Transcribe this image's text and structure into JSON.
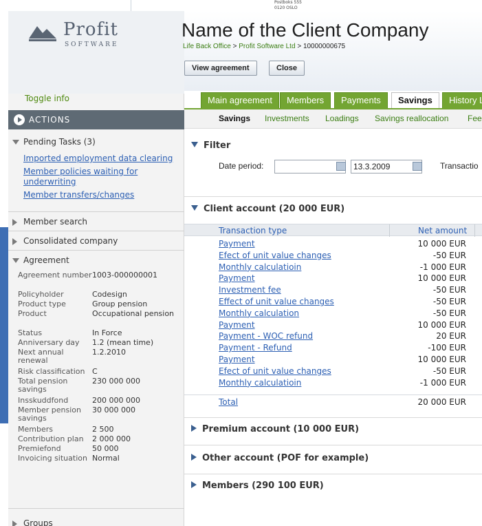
{
  "background": {
    "address_lines": [
      "Postboks 555",
      "0120 OSLO"
    ]
  },
  "logo": {
    "name": "Profit",
    "sub": "SOFTWARE"
  },
  "sidebar": {
    "toggle_info": "Toggle info",
    "actions_label": "ACTIONS",
    "pending_tasks": {
      "title": "Pending Tasks (3)",
      "links": [
        "Imported employment data clearing",
        "Member policies waiting for underwriting",
        "Member transfers/changes"
      ]
    },
    "sections": {
      "member_search": "Member search",
      "consolidated_company": "Consolidated company",
      "agreement": "Agreement",
      "groups": "Groups"
    },
    "agreement_rows": [
      {
        "label": "Agreement number",
        "value": "1003-000000001"
      },
      {
        "label": "Policyholder",
        "value": "Codesign"
      },
      {
        "label": "Product type",
        "value": "Group pension"
      },
      {
        "label": "Product",
        "value": "Occupational pension"
      },
      {
        "label": "Status",
        "value": "In Force"
      },
      {
        "label": "Anniversary day",
        "value": "1.2 (mean time)"
      },
      {
        "label": "Next annual renewal",
        "value": "1.2.2010"
      },
      {
        "label": "Risk classification",
        "value": "C"
      },
      {
        "label": "Total pension savings",
        "value": "230 000 000"
      },
      {
        "label": "Insskuddfond",
        "value": "200 000 000"
      },
      {
        "label": "Member pension savings",
        "value": "30 000 000"
      },
      {
        "label": "Members",
        "value": "2 500"
      },
      {
        "label": "Contribution plan",
        "value": "2 000 000"
      },
      {
        "label": "Premiefond",
        "value": "50 000"
      },
      {
        "label": "Invoicing situation",
        "value": "Normal"
      }
    ]
  },
  "header": {
    "title": "Name of the Client Company",
    "breadcrumb": {
      "first": "Life Back Office",
      "second": "Profit Software Ltd",
      "third": "10000000675",
      "sep": ">"
    },
    "buttons": {
      "view_agreement": "View agreement",
      "close": "Close"
    }
  },
  "tabs": [
    "Main agreement",
    "Members",
    "Payments",
    "Savings",
    "History L"
  ],
  "active_tab": "Savings",
  "subnav": [
    "Savings",
    "Investments",
    "Loadings",
    "Savings reallocation",
    "Fee"
  ],
  "filter": {
    "title": "Filter",
    "date_period_label": "Date period:",
    "date_from": "",
    "date_to": "13.3.2009",
    "transaction_label": "Transactio"
  },
  "client_account": {
    "title": "Client account (20 000 EUR)",
    "columns": [
      "Transaction type",
      "Net amount"
    ],
    "rows": [
      {
        "type": "Payment",
        "amount": "10 000 EUR"
      },
      {
        "type": "Efect of unit value changes",
        "amount": "-50 EUR"
      },
      {
        "type": "Monthly calculatioin",
        "amount": "-1 000 EUR"
      },
      {
        "type": "Payment",
        "amount": "10 000 EUR"
      },
      {
        "type": "Investment fee",
        "amount": "-50 EUR"
      },
      {
        "type": "Effect of unit value changes",
        "amount": "-50 EUR"
      },
      {
        "type": "Monthly calculation",
        "amount": "-50 EUR"
      },
      {
        "type": "Payment",
        "amount": "10 000 EUR"
      },
      {
        "type": "Payment - WOC refund",
        "amount": "20 EUR"
      },
      {
        "type": "Payment - Refund",
        "amount": "-100 EUR"
      },
      {
        "type": "Payment",
        "amount": "10 000 EUR"
      },
      {
        "type": "Efect of unit value changes",
        "amount": "-50 EUR"
      },
      {
        "type": "Monthly calculatioin",
        "amount": "-1 000 EUR"
      }
    ],
    "total_label": "Total",
    "total_amount": "20 000 EUR"
  },
  "collapsed_sections": [
    "Premium account (10 000 EUR)",
    "Other account (POF for example)",
    "Members (290 100 EUR)"
  ],
  "colors": {
    "tab_green": "#73a532",
    "link_blue": "#2c5fb3",
    "actions_bar": "#5e6a74"
  }
}
